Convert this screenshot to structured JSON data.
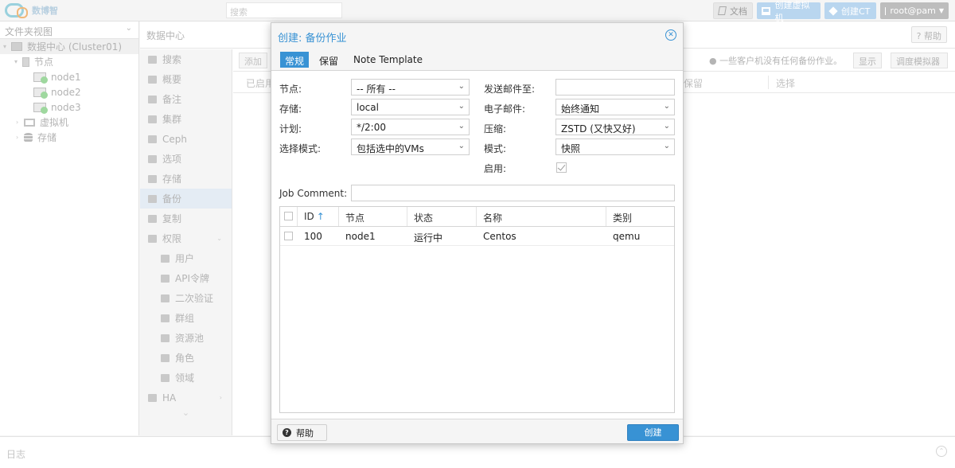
{
  "topbar": {
    "logo_text": "数博智",
    "search_placeholder": "搜索",
    "docs_label": "文档",
    "create_vm_label": "创建虚拟机",
    "create_ct_label": "创建CT",
    "user_label": "root@pam"
  },
  "tree": {
    "view_select": "文件夹视图",
    "datacenter": "数据中心 (Cluster01)",
    "nodes_group": "节点",
    "nodes": [
      "node1",
      "node2",
      "node3"
    ],
    "vms_group": "虚拟机",
    "storage_group": "存储"
  },
  "main": {
    "header_title": "数据中心",
    "help_label": "帮助",
    "nav": [
      "搜索",
      "概要",
      "备注",
      "集群",
      "Ceph",
      "选项",
      "存储",
      "备份",
      "复制",
      "权限"
    ],
    "perm_children": [
      "用户",
      "API令牌",
      "二次验证",
      "群组",
      "资源池",
      "角色",
      "领域"
    ],
    "nav_ha": "HA",
    "toolbar": {
      "add_label": "添加",
      "info_text": "一些客户机没有任何备份作业。",
      "show_label": "显示",
      "schedule_sim_label": "调度模拟器"
    },
    "grid_headers": {
      "enabled": "已启用",
      "retention": "保留",
      "selection": "选择"
    }
  },
  "log": {
    "label": "日志"
  },
  "modal": {
    "title": "创建: 备份作业",
    "tabs": [
      "常规",
      "保留",
      "Note Template"
    ],
    "form": {
      "node_label": "节点:",
      "node_value": "-- 所有 --",
      "storage_label": "存储:",
      "storage_value": "local",
      "schedule_label": "计划:",
      "schedule_value": "*/2:00",
      "selection_mode_label": "选择模式:",
      "selection_mode_value": "包括选中的VMs",
      "send_email_label": "发送邮件至:",
      "send_email_value": "",
      "email_label": "电子邮件:",
      "email_value": "始终通知",
      "compression_label": "压缩:",
      "compression_value": "ZSTD (又快又好)",
      "mode_label": "模式:",
      "mode_value": "快照",
      "enable_label": "启用:",
      "enable_checked": true,
      "job_comment_label": "Job Comment:",
      "job_comment_value": ""
    },
    "vm_table": {
      "columns": [
        "ID",
        "节点",
        "状态",
        "名称",
        "类别"
      ],
      "sort_indicator": "↑",
      "rows": [
        {
          "id": "100",
          "node": "node1",
          "status": "运行中",
          "name": "Centos",
          "type": "qemu"
        }
      ]
    },
    "footer": {
      "help_label": "帮助",
      "create_label": "创建"
    }
  },
  "colors": {
    "accent": "#3892d4"
  }
}
